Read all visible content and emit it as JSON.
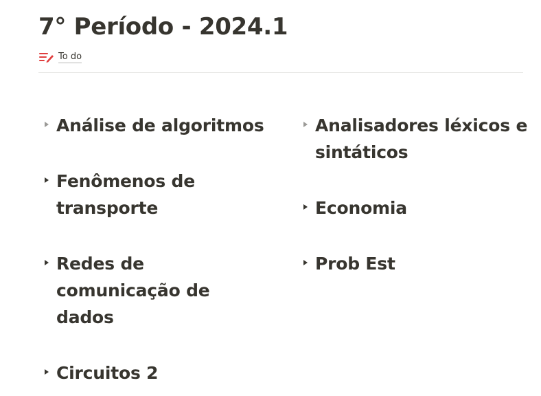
{
  "page": {
    "title": "7° Período - 2024.1",
    "tag": {
      "icon": "todo-list-icon",
      "label": "To do",
      "color": "#e03e3e"
    }
  },
  "toggles": {
    "left": [
      {
        "label": "Análise de algoritmos"
      },
      {
        "label": "Fenômenos de transporte"
      },
      {
        "label": "Redes de comunicação de dados"
      },
      {
        "label": "Circuitos 2"
      }
    ],
    "right": [
      {
        "label": "Analisadores léxicos e sintáticos"
      },
      {
        "label": "Economia"
      },
      {
        "label": "Prob Est"
      }
    ]
  },
  "colors": {
    "text": "#37352f",
    "arrow_muted": "#9b9a97",
    "divider": "#e9e9e7"
  }
}
